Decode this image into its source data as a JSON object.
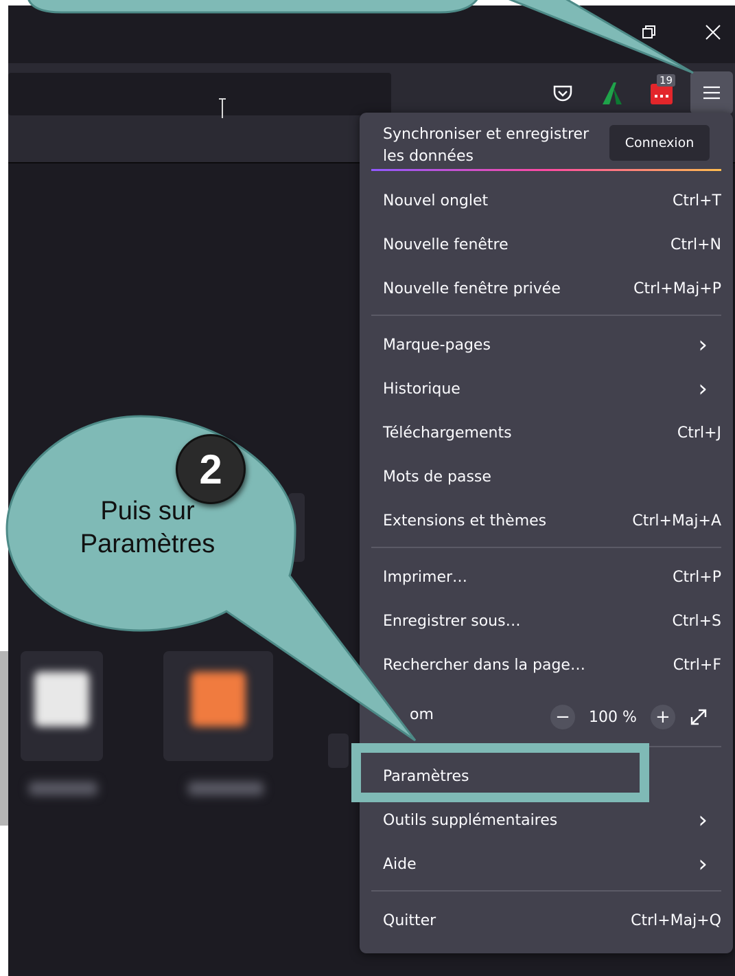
{
  "window": {
    "controls": {
      "restore_icon": "restore-icon",
      "close_icon": "close-icon"
    }
  },
  "toolbar": {
    "icons": [
      "pocket-icon",
      "extension-green-a-icon",
      "extension-red-icon",
      "hamburger-menu-icon"
    ],
    "badge_count": "19"
  },
  "menu": {
    "sync": {
      "title": "Synchroniser et enregistrer les données",
      "button": "Connexion"
    },
    "items": [
      {
        "label": "Nouvel onglet",
        "shortcut": "Ctrl+T"
      },
      {
        "label": "Nouvelle fenêtre",
        "shortcut": "Ctrl+N"
      },
      {
        "label": "Nouvelle fenêtre privée",
        "shortcut": "Ctrl+Maj+P"
      },
      {
        "label": "Marque-pages",
        "shortcut": ""
      },
      {
        "label": "Historique",
        "shortcut": ""
      },
      {
        "label": "Téléchargements",
        "shortcut": "Ctrl+J"
      },
      {
        "label": "Mots de passe",
        "shortcut": ""
      },
      {
        "label": "Extensions et thèmes",
        "shortcut": "Ctrl+Maj+A"
      },
      {
        "label": "Imprimer…",
        "shortcut": "Ctrl+P"
      },
      {
        "label": "Enregistrer sous…",
        "shortcut": "Ctrl+S"
      },
      {
        "label": "Rechercher dans la page…",
        "shortcut": "Ctrl+F"
      },
      {
        "label": "om",
        "shortcut": ""
      },
      {
        "label": "Paramètres",
        "shortcut": ""
      },
      {
        "label": "Outils supplémentaires",
        "shortcut": ""
      },
      {
        "label": "Aide",
        "shortcut": ""
      },
      {
        "label": "Quitter",
        "shortcut": "Ctrl+Maj+Q"
      }
    ],
    "zoom": {
      "minus": "−",
      "value": "100 %",
      "plus": "+"
    }
  },
  "callout": {
    "step": "2",
    "text_line1": "Puis sur",
    "text_line2": "Paramètres",
    "color": "#7fbab6"
  }
}
